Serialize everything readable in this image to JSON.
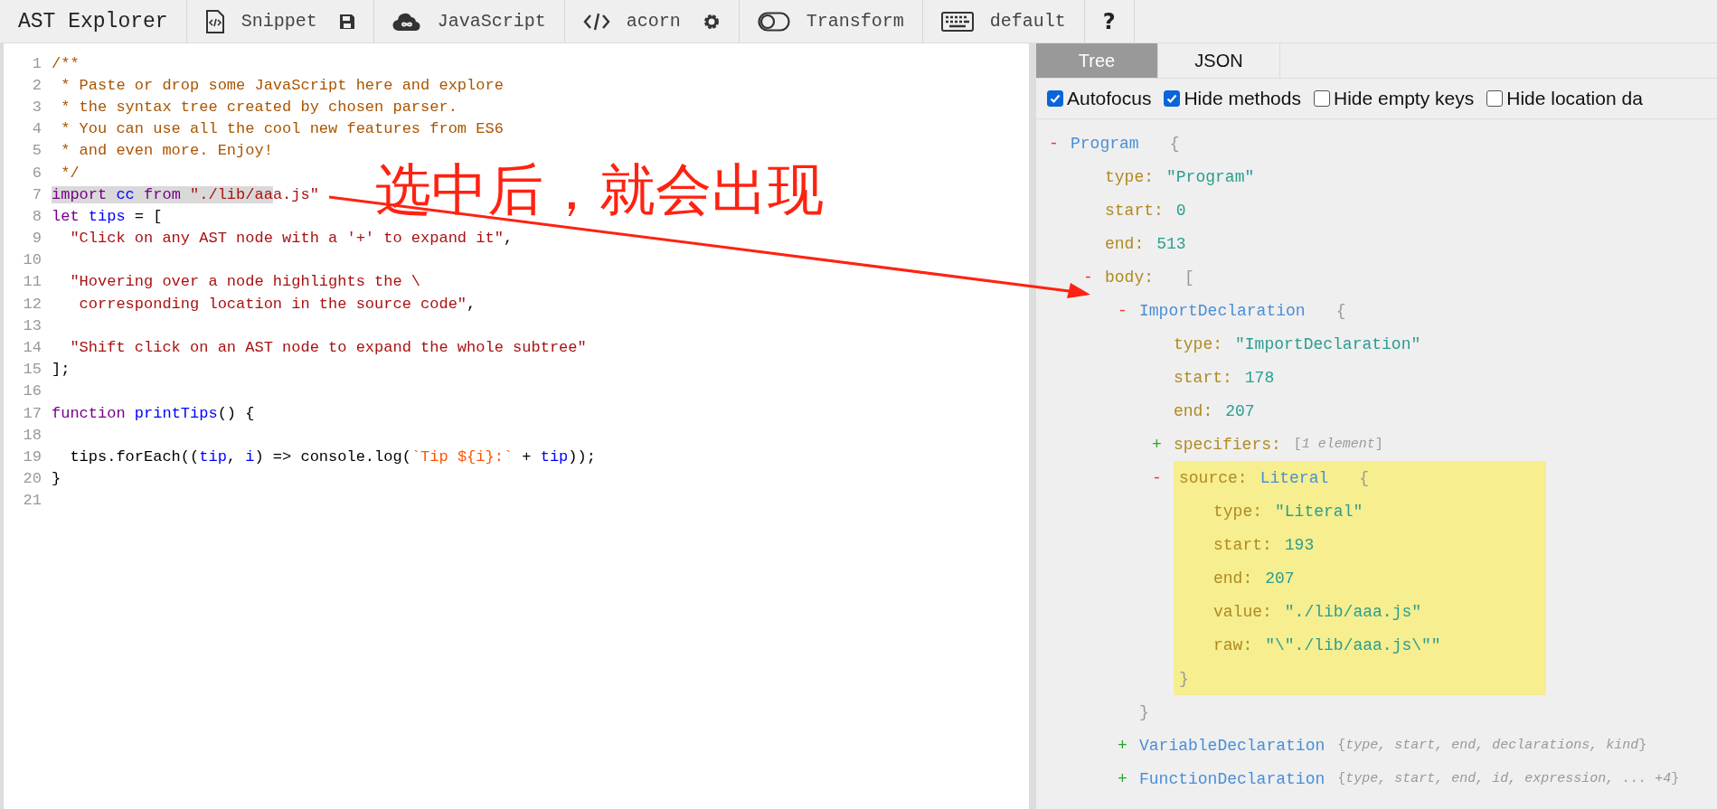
{
  "toolbar": [
    {
      "kind": "title",
      "label": "AST Explorer"
    },
    {
      "kind": "buttons",
      "buttons": [
        {
          "kind": "icon-label",
          "label": "Snippet"
        },
        {
          "kind": "icon"
        }
      ]
    },
    {
      "kind": "buttons",
      "buttons": [
        {
          "kind": "icon-label",
          "label": "JavaScript"
        }
      ]
    },
    {
      "kind": "buttons",
      "buttons": [
        {
          "kind": "icon-label",
          "label": "acorn"
        },
        {
          "kind": "icon"
        }
      ]
    },
    {
      "kind": "buttons",
      "buttons": [
        {
          "kind": "icon-label",
          "label": "Transform"
        }
      ]
    },
    {
      "kind": "buttons",
      "buttons": [
        {
          "kind": "icon-label",
          "label": "default"
        }
      ]
    },
    {
      "kind": "buttons",
      "buttons": [
        {
          "kind": "text",
          "label": "?"
        }
      ]
    }
  ],
  "editor": {
    "lines": [
      {
        "number": "1",
        "segments": [
          {
            "kind": "comment",
            "text": "/**"
          }
        ]
      },
      {
        "number": "2",
        "segments": [
          {
            "kind": "comment",
            "text": " * Paste or drop some JavaScript here and explore"
          }
        ]
      },
      {
        "number": "3",
        "segments": [
          {
            "kind": "comment",
            "text": " * the syntax tree created by chosen parser."
          }
        ]
      },
      {
        "number": "4",
        "segments": [
          {
            "kind": "comment",
            "text": " * You can use all the cool new features from ES6"
          }
        ]
      },
      {
        "number": "5",
        "segments": [
          {
            "kind": "comment",
            "text": " * and even more. Enjoy!"
          }
        ]
      },
      {
        "number": "6",
        "segments": [
          {
            "kind": "comment",
            "text": " */"
          }
        ]
      },
      {
        "number": "7",
        "segments": [
          {
            "kind": "keyword",
            "text": "import",
            "selected": true
          },
          {
            "kind": "def",
            "text": " cc",
            "selected": true
          },
          {
            "kind": "keyword",
            "text": " from",
            "selected": true
          },
          {
            "kind": "string",
            "text": " \"./lib/aa",
            "selected": true
          },
          {
            "kind": "string",
            "text": "a.js\"",
            "selected": false
          }
        ]
      },
      {
        "number": "8",
        "segments": [
          {
            "kind": "keyword",
            "text": "let"
          },
          {
            "kind": "def",
            "text": " tips"
          },
          {
            "kind": "plain",
            "text": " = ["
          }
        ]
      },
      {
        "number": "9",
        "segments": [
          {
            "kind": "string",
            "text": "  \"Click on any AST node with a '+' to expand it\""
          },
          {
            "kind": "plain",
            "text": ","
          }
        ]
      },
      {
        "number": "10"
      },
      {
        "number": "11",
        "segments": [
          {
            "kind": "string",
            "text": "  \"Hovering over a node highlights the \\"
          }
        ]
      },
      {
        "number": "12",
        "segments": [
          {
            "kind": "string",
            "text": "   corresponding location in the source code\""
          },
          {
            "kind": "plain",
            "text": ","
          }
        ]
      },
      {
        "number": "13"
      },
      {
        "number": "14",
        "segments": [
          {
            "kind": "string",
            "text": "  \"Shift click on an AST node to expand the whole subtree\""
          }
        ]
      },
      {
        "number": "15",
        "segments": [
          {
            "kind": "plain",
            "text": "];"
          }
        ]
      },
      {
        "number": "16"
      },
      {
        "number": "17",
        "segments": [
          {
            "kind": "keyword",
            "text": "function"
          },
          {
            "kind": "def",
            "text": " printTips"
          },
          {
            "kind": "plain",
            "text": "() {"
          }
        ]
      },
      {
        "number": "18"
      },
      {
        "number": "19",
        "segments": [
          {
            "kind": "plain",
            "text": "  tips.forEach(("
          },
          {
            "kind": "def",
            "text": "tip"
          },
          {
            "kind": "plain",
            "text": ", "
          },
          {
            "kind": "def",
            "text": "i"
          },
          {
            "kind": "plain",
            "text": ") => console.log("
          },
          {
            "kind": "template",
            "text": "`Tip ${i}:`"
          },
          {
            "kind": "plain",
            "text": " + "
          },
          {
            "kind": "def",
            "text": "tip"
          },
          {
            "kind": "plain",
            "text": "));"
          }
        ]
      },
      {
        "number": "20",
        "segments": [
          {
            "kind": "plain",
            "text": "}"
          }
        ]
      },
      {
        "number": "21"
      }
    ]
  },
  "annotation": {
    "text": "选中后，就会出现"
  },
  "output": {
    "tabs": [
      {
        "label": "Tree",
        "selected": true
      },
      {
        "label": "JSON",
        "selected": false
      }
    ],
    "options": [
      {
        "label": "Autofocus",
        "checked": true
      },
      {
        "label": "Hide methods",
        "checked": true
      },
      {
        "label": "Hide empty keys",
        "checked": false
      },
      {
        "label": "Hide location da",
        "checked": false
      }
    ],
    "tree": [
      {
        "kind": "object",
        "toggle": "-",
        "expanded": true,
        "type_name": "Program",
        "open": "{",
        "children": [
          {
            "kind": "value",
            "key": "type:",
            "value": "\"Program\""
          },
          {
            "kind": "value",
            "key": "start:",
            "value": "0"
          },
          {
            "kind": "value",
            "key": "end:",
            "value": "513"
          },
          {
            "kind": "array",
            "toggle": "-",
            "expanded": true,
            "key": "body:",
            "open": "[",
            "children": [
              {
                "kind": "object",
                "toggle": "-",
                "expanded": true,
                "type_name": "ImportDeclaration",
                "open": "{",
                "close": "}",
                "children": [
                  {
                    "kind": "value",
                    "key": "type:",
                    "value": "\"ImportDeclaration\""
                  },
                  {
                    "kind": "value",
                    "key": "start:",
                    "value": "178"
                  },
                  {
                    "kind": "value",
                    "key": "end:",
                    "value": "207"
                  },
                  {
                    "kind": "array",
                    "toggle": "+",
                    "expanded": false,
                    "key": "specifiers:",
                    "summary": "[*1 element*]"
                  },
                  {
                    "kind": "object",
                    "toggle": "-",
                    "expanded": true,
                    "highlighted": true,
                    "key": "source:",
                    "type_name": "Literal",
                    "open": "{",
                    "close": "}",
                    "children": [
                      {
                        "kind": "value",
                        "key": "type:",
                        "value": "\"Literal\""
                      },
                      {
                        "kind": "value",
                        "key": "start:",
                        "value": "193"
                      },
                      {
                        "kind": "value",
                        "key": "end:",
                        "value": "207"
                      },
                      {
                        "kind": "value",
                        "key": "value:",
                        "value": "\"./lib/aaa.js\""
                      },
                      {
                        "kind": "value",
                        "key": "raw:",
                        "value": "\"\\\"./lib/aaa.js\\\"\""
                      }
                    ]
                  }
                ]
              },
              {
                "kind": "object",
                "toggle": "+",
                "expanded": false,
                "type_name": "VariableDeclaration",
                "summary": "{*type, start, end, declarations, kind*}"
              },
              {
                "kind": "object",
                "toggle": "+",
                "expanded": false,
                "type_name": "FunctionDeclaration",
                "summary": "{*type, start, end, id, expression, ... +4*}"
              }
            ]
          }
        ]
      }
    ]
  }
}
